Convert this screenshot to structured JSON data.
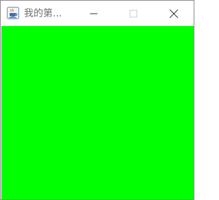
{
  "window": {
    "title": "我的第...",
    "icon": "java-coffee-cup-icon"
  },
  "controls": {
    "minimize_icon": "minimize-icon",
    "maximize_icon": "maximize-icon",
    "close_icon": "close-icon"
  },
  "content": {
    "background_color": "#00ff00"
  },
  "colors": {
    "title_text": "#6f6f6f",
    "window_border": "#8a8a8a",
    "titlebar_bg": "#ffffff"
  }
}
